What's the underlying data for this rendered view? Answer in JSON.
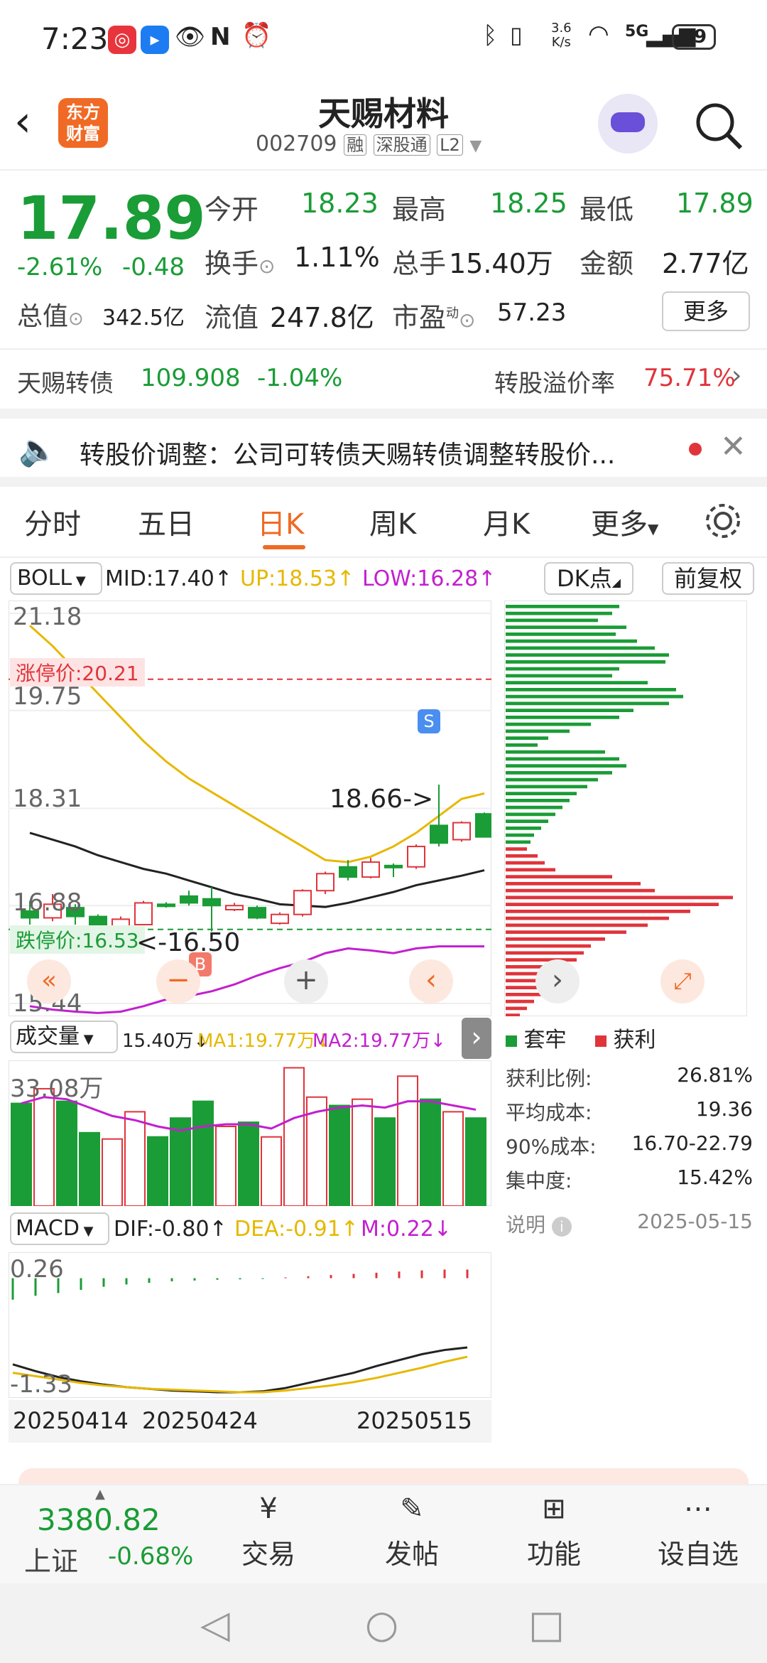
{
  "status": {
    "time": "7:23",
    "net_speed_top": "3.6",
    "net_speed_unit": "K/s",
    "battery": "29",
    "net_type": "5G"
  },
  "header": {
    "title": "天赐材料",
    "code": "002709",
    "tags": [
      "融",
      "深股通",
      "L2"
    ],
    "brand_logo": "东方财富"
  },
  "quote": {
    "price": "17.89",
    "change_pct": "-2.61%",
    "change": "-0.48",
    "open_label": "今开",
    "open": "18.23",
    "high_label": "最高",
    "high": "18.25",
    "low_label": "最低",
    "low": "17.89",
    "turnover_label": "换手",
    "turnover": "1.11%",
    "volume_label": "总手",
    "volume": "15.40万",
    "amount_label": "金额",
    "amount": "2.77亿",
    "mcap_label": "总值",
    "mcap": "342.5亿",
    "float_label": "流值",
    "float": "247.8亿",
    "pe_label": "市盈",
    "pe_sup": "动",
    "pe": "57.23",
    "more": "更多"
  },
  "convertible": {
    "name": "天赐转债",
    "price": "109.908",
    "change": "-1.04%",
    "premium_label": "转股溢价率",
    "premium": "75.71%"
  },
  "notice": {
    "text": "转股价调整：公司可转债天赐转债调整转股价..."
  },
  "tabs": [
    {
      "label": "分时"
    },
    {
      "label": "五日"
    },
    {
      "label": "日K"
    },
    {
      "label": "周K"
    },
    {
      "label": "月K"
    },
    {
      "label": "更多"
    }
  ],
  "indicator": {
    "name": "BOLL",
    "mid": "MID:17.40",
    "up": "UP:18.53",
    "low": "LOW:16.28",
    "dk": "DK点",
    "adjust": "前复权"
  },
  "kchart": {
    "y_top": "21.18",
    "limit_up": "涨停价:20.21",
    "y2": "19.75",
    "y3": "18.31",
    "y4": "16.88",
    "limit_down": "跌停价:16.53",
    "y_bottom": "15.44",
    "max_label": "18.66",
    "min_label": "16.50",
    "buy": "B",
    "sell": "S"
  },
  "volume": {
    "name": "成交量",
    "vol": "15.40万",
    "ma1": "MA1:19.77万",
    "ma2": "MA2:19.77万",
    "max": "33.08万"
  },
  "macd": {
    "name": "MACD",
    "dif": "DIF:-0.80",
    "dea": "DEA:-0.91",
    "m": "M:0.22",
    "top": "0.26",
    "bottom": "-1.33"
  },
  "dates": [
    "20250414",
    "20250424",
    "20250515"
  ],
  "chips": {
    "legend_trapped": "套牢",
    "legend_profit": "获利",
    "rows": [
      {
        "label": "获利比例:",
        "value": "26.81%"
      },
      {
        "label": "平均成本:",
        "value": "19.36"
      },
      {
        "label": "90%成本:",
        "value": "16.70-22.79"
      },
      {
        "label": "集中度:",
        "value": "15.42%"
      }
    ],
    "note": "说明",
    "date": "2025-05-15"
  },
  "bottom": {
    "index_value": "3380.82",
    "index_name": "上证",
    "index_change": "-0.68%",
    "items": [
      "交易",
      "发帖",
      "功能",
      "设自选"
    ]
  },
  "candles": [
    {
      "o": 16.8,
      "c": 16.7,
      "h": 16.95,
      "l": 16.6
    },
    {
      "o": 16.7,
      "c": 16.9,
      "h": 17.05,
      "l": 16.65
    },
    {
      "o": 16.85,
      "c": 16.72,
      "h": 16.9,
      "l": 16.6
    },
    {
      "o": 16.72,
      "c": 16.6,
      "h": 16.75,
      "l": 16.55
    },
    {
      "o": 16.55,
      "c": 16.68,
      "h": 16.72,
      "l": 16.5
    },
    {
      "o": 16.6,
      "c": 16.92,
      "h": 16.95,
      "l": 16.58
    },
    {
      "o": 16.9,
      "c": 16.88,
      "h": 16.93,
      "l": 16.85
    },
    {
      "o": 17.02,
      "c": 16.92,
      "h": 17.1,
      "l": 16.88
    },
    {
      "o": 16.98,
      "c": 16.88,
      "h": 17.15,
      "l": 16.5
    },
    {
      "o": 16.82,
      "c": 16.88,
      "h": 16.92,
      "l": 16.8
    },
    {
      "o": 16.85,
      "c": 16.7,
      "h": 16.88,
      "l": 16.68
    },
    {
      "o": 16.62,
      "c": 16.75,
      "h": 16.78,
      "l": 16.6
    },
    {
      "o": 16.75,
      "c": 17.1,
      "h": 17.12,
      "l": 16.72
    },
    {
      "o": 17.1,
      "c": 17.35,
      "h": 17.38,
      "l": 17.05
    },
    {
      "o": 17.45,
      "c": 17.3,
      "h": 17.55,
      "l": 17.25
    },
    {
      "o": 17.3,
      "c": 17.52,
      "h": 17.58,
      "l": 17.28
    },
    {
      "o": 17.47,
      "c": 17.45,
      "h": 17.5,
      "l": 17.3
    },
    {
      "o": 17.45,
      "c": 17.75,
      "h": 17.78,
      "l": 17.42
    },
    {
      "o": 18.06,
      "c": 17.8,
      "h": 18.66,
      "l": 17.75
    },
    {
      "o": 17.85,
      "c": 18.1,
      "h": 18.12,
      "l": 17.82
    },
    {
      "o": 18.23,
      "c": 17.89,
      "h": 18.25,
      "l": 17.89
    }
  ],
  "vols": [
    24.5,
    28.0,
    25.0,
    17.5,
    16.0,
    22.5,
    16.5,
    21.0,
    25.0,
    19.0,
    20.0,
    16.5,
    33.0,
    26.0,
    24.0,
    25.5,
    21.0,
    31.0,
    25.5,
    22.5,
    21.0
  ],
  "macd_bars": [
    -0.55,
    -0.45,
    -0.38,
    -0.3,
    -0.22,
    -0.16,
    -0.12,
    -0.08,
    -0.06,
    -0.04,
    -0.03,
    -0.02,
    0.02,
    0.05,
    0.08,
    0.11,
    0.14,
    0.17,
    0.2,
    0.22,
    0.22
  ],
  "colors": {
    "up": "#e0343b",
    "down": "#1a9c36",
    "accent": "#f06a25",
    "mid": "#222",
    "upper": "#e6b800",
    "lower": "#c21fcf"
  }
}
